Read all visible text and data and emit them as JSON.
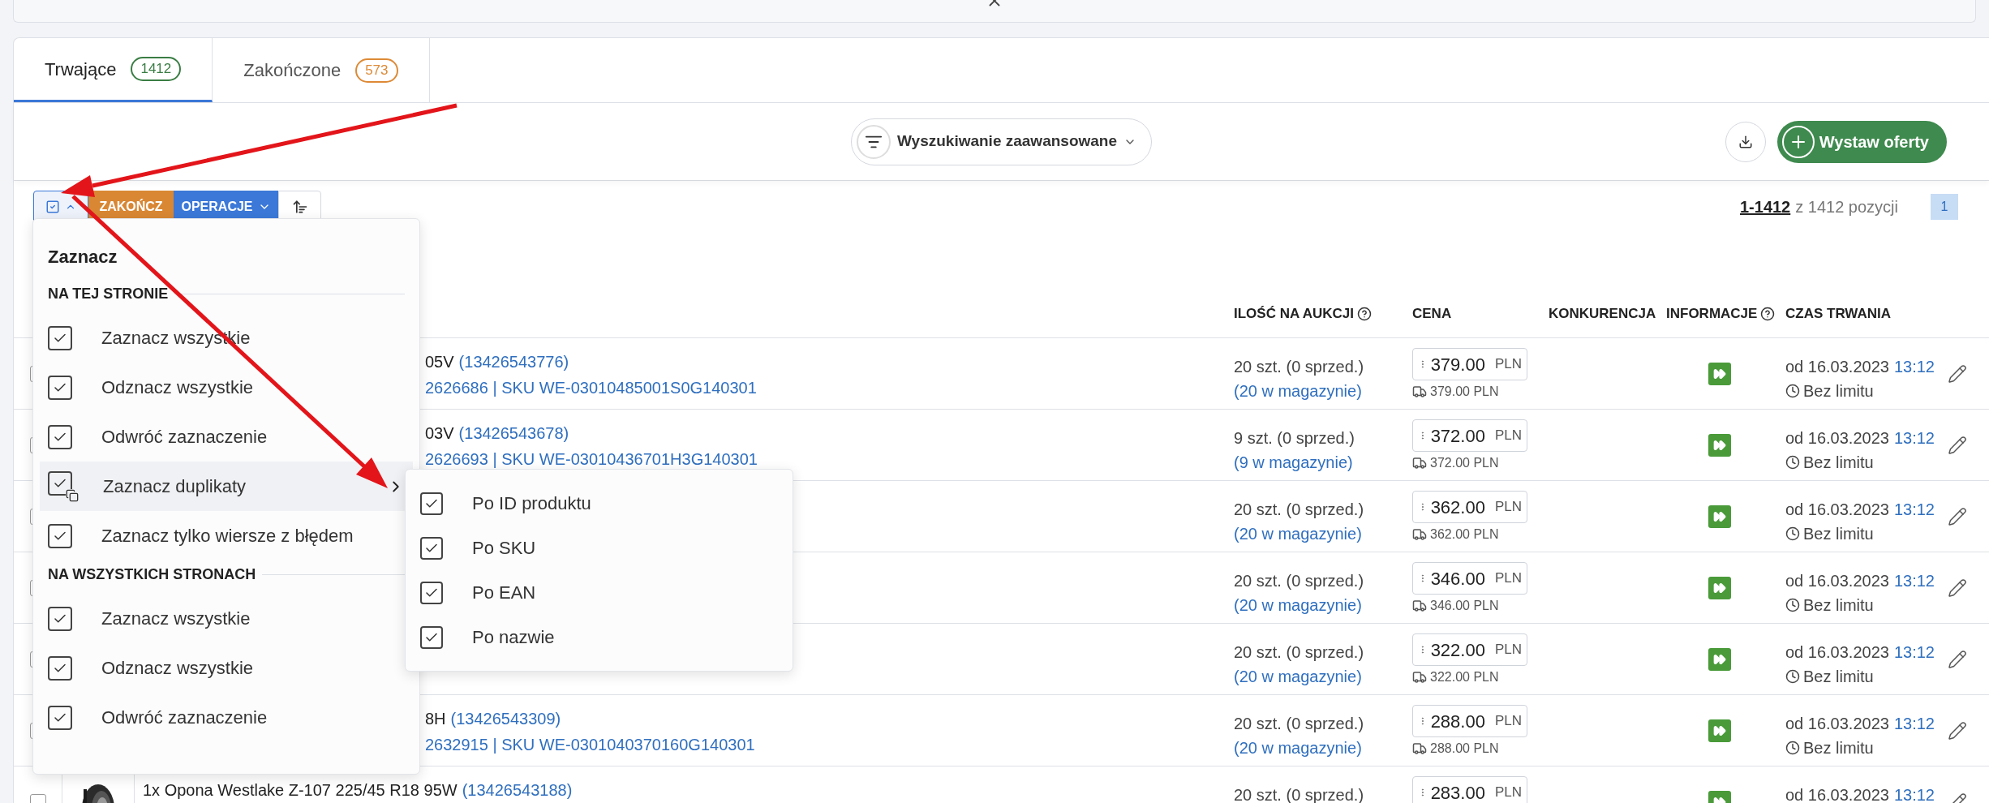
{
  "tabs": [
    {
      "label": "Trwające",
      "count": "1412",
      "selected": true,
      "color": "#3a7d44"
    },
    {
      "label": "Zakończone",
      "count": "573",
      "selected": false,
      "color": "#dd8a36"
    }
  ],
  "toolbar": {
    "advanced_search": "Wyszukiwanie zaawansowane",
    "add_button": "Wystaw oferty"
  },
  "selection_bar": {
    "finish_button": "ZAKOŃCZ",
    "operations_button": "OPERACJE",
    "range": "1-1412",
    "range_suffix": "z 1412 pozycji",
    "pages": [
      {
        "label": "1",
        "selected": true
      }
    ]
  },
  "table": {
    "columns": [
      {
        "label": "ILOŚĆ NA AUKCJI",
        "help": true
      },
      {
        "label": "CENA",
        "help": false
      },
      {
        "label": "KONKURENCJA",
        "help": false
      },
      {
        "label": "INFORMACJE",
        "help": true
      },
      {
        "label": "CZAS TRWANIA",
        "help": false
      }
    ],
    "rows": [
      {
        "checked": false,
        "truncated_left": true,
        "title": "05V",
        "offer_id": "(13426543776)",
        "codes": "2626686 | SKU WE-03010485001S0G140301",
        "qty": "20 szt. (0 sprzed.)",
        "stock": "(20 w magazynie)",
        "price": "379.00",
        "currency": "PLN",
        "shipping": "379.00 PLN",
        "date": "od 16.03.2023",
        "time": "13:12",
        "limit": "Bez limitu"
      },
      {
        "checked": false,
        "truncated_left": true,
        "title": "03V",
        "offer_id": "(13426543678)",
        "codes": "2626693 | SKU WE-03010436701H3G140301",
        "qty": "9 szt. (0 sprzed.)",
        "stock": "(9 w magazynie)",
        "price": "372.00",
        "currency": "PLN",
        "shipping": "372.00 PLN",
        "date": "od 16.03.2023",
        "time": "13:12",
        "limit": "Bez limitu"
      },
      {
        "checked": false,
        "qty": "20 szt. (0 sprzed.)",
        "stock": "(20 w magazynie)",
        "price": "362.00",
        "currency": "PLN",
        "shipping": "362.00 PLN",
        "date": "od 16.03.2023",
        "time": "13:12",
        "limit": "Bez limitu"
      },
      {
        "checked": false,
        "qty": "20 szt. (0 sprzed.)",
        "stock": "(20 w magazynie)",
        "price": "346.00",
        "currency": "PLN",
        "shipping": "346.00 PLN",
        "date": "od 16.03.2023",
        "time": "13:12",
        "limit": "Bez limitu"
      },
      {
        "checked": false,
        "qty": "20 szt. (0 sprzed.)",
        "stock": "(20 w magazynie)",
        "price": "322.00",
        "currency": "PLN",
        "shipping": "322.00 PLN",
        "date": "od 16.03.2023",
        "time": "13:12",
        "limit": "Bez limitu"
      },
      {
        "checked": false,
        "truncated_left": true,
        "title": "8H",
        "offer_id": "(13426543309)",
        "codes": "2632915 | SKU WE-0301040370160G140301",
        "qty": "20 szt. (0 sprzed.)",
        "stock": "(20 w magazynie)",
        "price": "288.00",
        "currency": "PLN",
        "shipping": "288.00 PLN",
        "date": "od 16.03.2023",
        "time": "13:12",
        "limit": "Bez limitu"
      },
      {
        "checked": false,
        "image": true,
        "truncated_left": false,
        "title": "1x Opona Westlake Z-107 225/45 R18 95W",
        "offer_id": "(13426543188)",
        "qty": "20 szt. (0 sprzed.)",
        "price": "283.00",
        "currency": "PLN",
        "date": "od 16.03.2023",
        "time": "13:12"
      }
    ]
  },
  "select_menu": {
    "title": "Zaznacz",
    "sections": [
      {
        "heading": "NA TEJ STRONIE",
        "items": [
          {
            "label": "Zaznacz wszystkie",
            "kind": "action",
            "selected": false
          },
          {
            "label": "Odznacz wszystkie",
            "kind": "action",
            "selected": false
          },
          {
            "label": "Odwróć zaznaczenie",
            "kind": "action",
            "selected": false
          },
          {
            "label": "Zaznacz duplikaty",
            "kind": "submenu",
            "selected": true
          },
          {
            "label": "Zaznacz tylko wiersze z błędem",
            "kind": "action",
            "selected": false
          }
        ]
      },
      {
        "heading": "NA WSZYSTKICH STRONACH",
        "items": [
          {
            "label": "Zaznacz wszystkie",
            "kind": "action",
            "selected": false
          },
          {
            "label": "Odznacz wszystkie",
            "kind": "action",
            "selected": false
          },
          {
            "label": "Odwróć zaznaczenie",
            "kind": "action",
            "selected": false
          }
        ]
      }
    ]
  },
  "duplicates_submenu": {
    "items": [
      {
        "label": "Po ID produktu",
        "checked": true
      },
      {
        "label": "Po SKU",
        "checked": true
      },
      {
        "label": "Po EAN",
        "checked": true
      },
      {
        "label": "Po nazwie",
        "checked": true
      }
    ]
  }
}
